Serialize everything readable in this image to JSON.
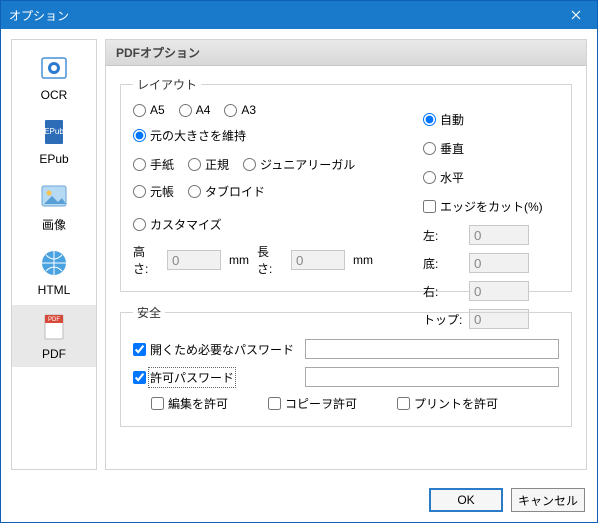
{
  "window": {
    "title": "オプション"
  },
  "sidebar": {
    "items": [
      {
        "label": "OCR"
      },
      {
        "label": "EPub"
      },
      {
        "label": "画像"
      },
      {
        "label": "HTML"
      },
      {
        "label": "PDF"
      }
    ]
  },
  "main": {
    "header": "PDFオプション",
    "layout": {
      "legend": "レイアウト",
      "paper": {
        "a5": "A5",
        "a4": "A4",
        "a3": "A3",
        "keep": "元の大きさを維持",
        "letter": "手紙",
        "legal": "正規",
        "jrlegal": "ジュニアリーガル",
        "ledger": "元帳",
        "tabloid": "タブロイド",
        "custom": "カスタマイズ"
      },
      "dim": {
        "height_label": "高さ:",
        "height": "0",
        "mm1": "mm",
        "width_label": "長さ:",
        "width": "0",
        "mm2": "mm"
      },
      "orient": {
        "auto": "自動",
        "vertical": "垂直",
        "horizontal": "水平"
      },
      "edgecut": {
        "label": "エッジをカット(%)"
      },
      "margins": {
        "left_label": "左:",
        "left": "0",
        "bottom_label": "底:",
        "bottom": "0",
        "right_label": "右:",
        "right": "0",
        "top_label": "トップ:",
        "top": "0"
      }
    },
    "security": {
      "legend": "安全",
      "open_pw_label": "開くため必要なパスワード",
      "perm_pw_label": "許可パスワード",
      "allow_edit": "編集を許可",
      "allow_copy": "コピーヲ許可",
      "allow_print": "プリントを許可"
    }
  },
  "footer": {
    "ok": "OK",
    "cancel": "キャンセル"
  }
}
